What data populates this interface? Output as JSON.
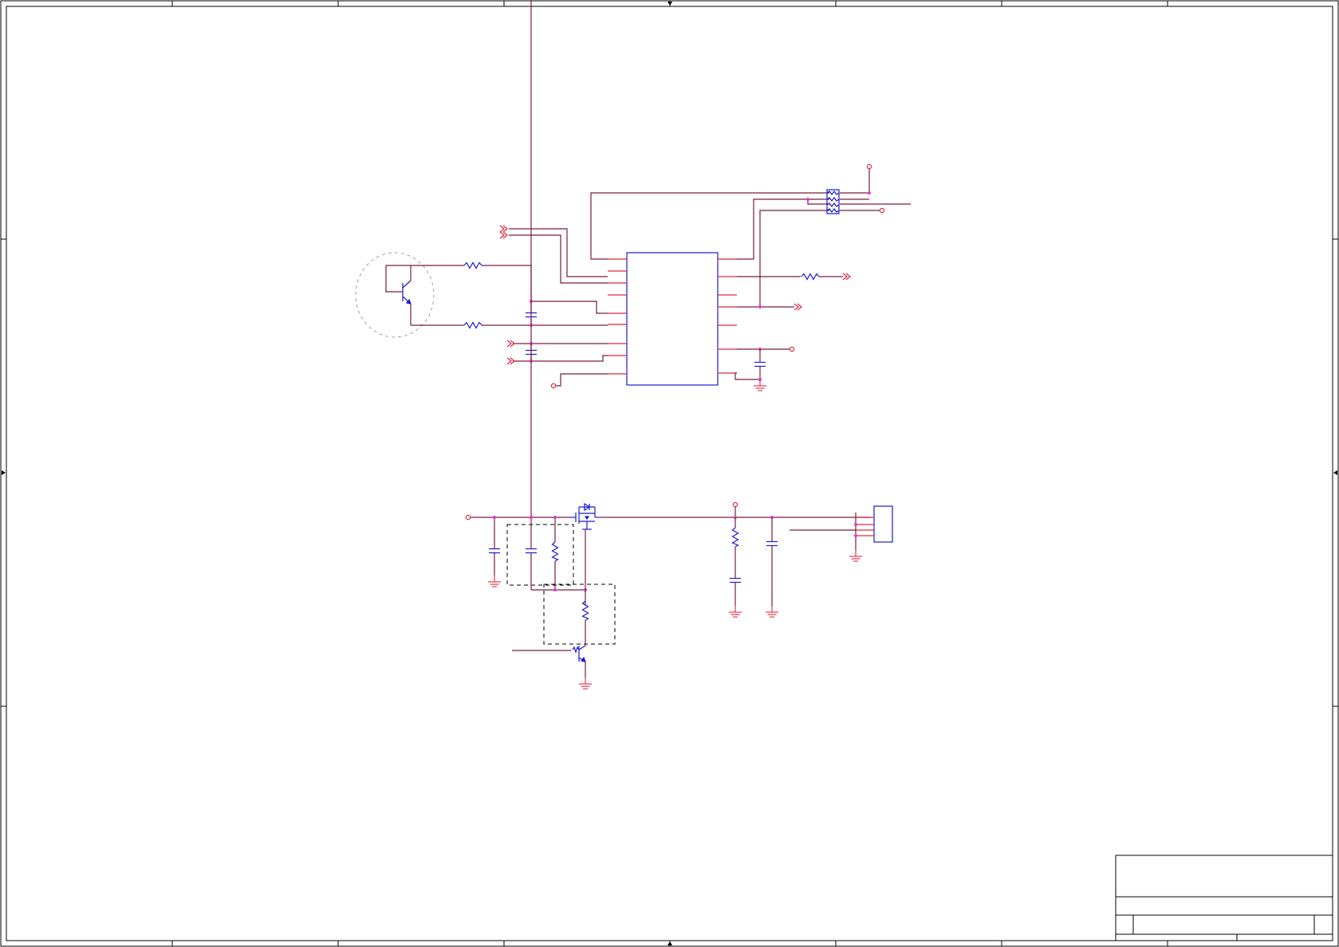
{
  "colors": {
    "wire": "#7a1c3c",
    "pin": "#e0283a",
    "component": "#1a1ad8",
    "junction": "#e03ad0",
    "frame": "#000000"
  }
}
